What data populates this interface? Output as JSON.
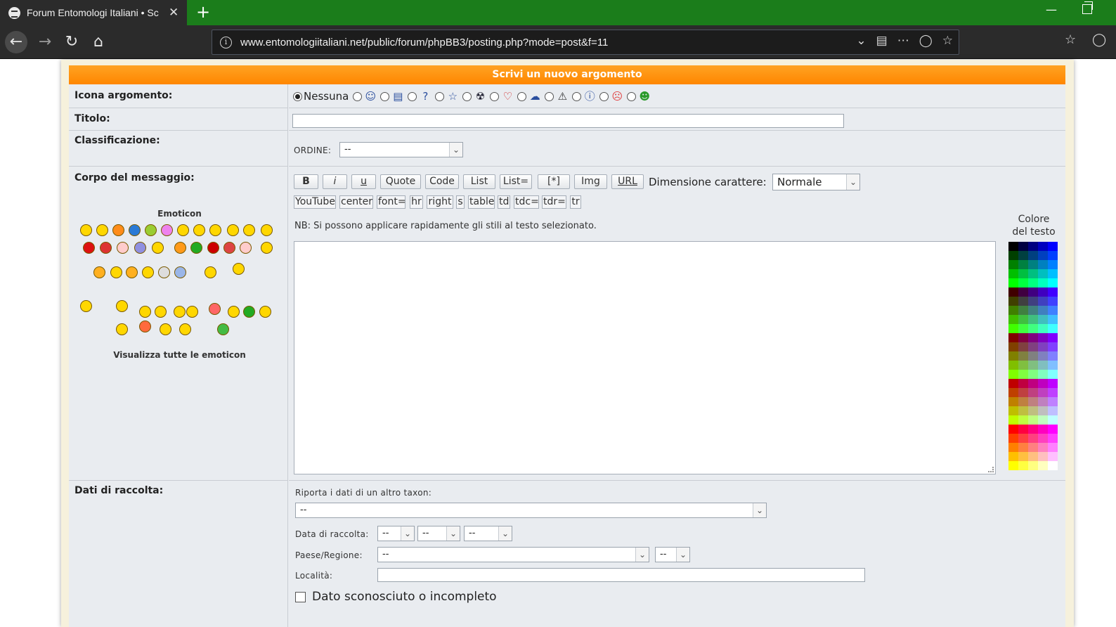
{
  "browser": {
    "tab_title": "Forum Entomologi Italiani • Sc",
    "tab_close": "✕",
    "new_tab": "+",
    "url": "www.entomologiitaliani.net/public/forum/phpBB3/posting.php?mode=post&f=11"
  },
  "form": {
    "header": "Scrivi un nuovo argomento",
    "topic_icon_label": "Icona argomento:",
    "topic_icon_none": "Nessuna",
    "topic_icons": [
      "users-icon",
      "document-icon",
      "question-icon",
      "star-icon",
      "radioactive-icon",
      "heart-icon",
      "speech-bubble-icon",
      "warning-icon",
      "info-icon",
      "angry-face-icon",
      "grin-face-icon"
    ],
    "title_label": "Titolo:",
    "classification_label": "Classificazione:",
    "ordine_label": "ORDINE:",
    "ordine_value": "--",
    "body_label": "Corpo del messaggio:",
    "toolbar_row1": [
      "B",
      "i",
      "u",
      "Quote",
      "Code",
      "List",
      "List=",
      "[*]",
      "Img",
      "URL"
    ],
    "font_size_label": "Dimensione carattere:",
    "font_size_value": "Normale",
    "toolbar_row2": [
      "YouTube",
      "center",
      "font=",
      "hr",
      "right",
      "s",
      "table",
      "td",
      "tdc=",
      "tdr=",
      "tr"
    ],
    "note": "NB: Si possono applicare rapidamente gli stili al testo selezionato.",
    "emoticons_title": "Emoticon",
    "emoticons_more": "Visualizza tutte le emoticon",
    "text_color_label_1": "Colore",
    "text_color_label_2": "del testo",
    "collection_label": "Dati di raccolta:",
    "other_taxon_label": "Riporta i dati di un altro taxon:",
    "other_taxon_value": "--",
    "date_label": "Data di raccolta:",
    "date_day": "--",
    "date_month": "--",
    "date_year": "--",
    "country_label": "Paese/Regione:",
    "country_value": "--",
    "region_value": "--",
    "locality_label": "Località:",
    "unknown_label": "Dato sconosciuto o incompleto"
  },
  "colors": {
    "accent": "#ff8c00",
    "tabbar": "#1b7d1b"
  }
}
